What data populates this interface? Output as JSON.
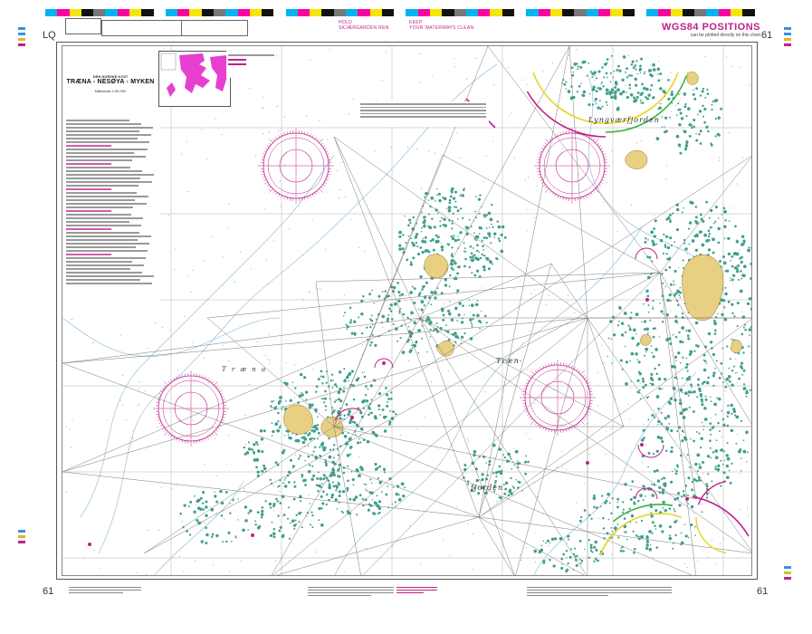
{
  "page": {
    "chart_number": "61",
    "corner_left": "LQ",
    "corner_right": "61"
  },
  "header": {
    "slogan_left": [
      "HOLD",
      "SKJÆRGARDEN REN"
    ],
    "slogan_right": [
      "KEEP",
      "YOUR WATERWAYS CLEAN"
    ],
    "wgs_title": "WGS84 POSITIONS",
    "wgs_sub": "can be plotted directly on this chart"
  },
  "title_block": {
    "pre_title": "DEN NORSKE KYST",
    "title": "TRÆNA - NESØYA - MYKEN",
    "scale": "Målestokk 1:50 000"
  },
  "place_names": {
    "lyngvaer": "Lyngværfjorden",
    "traena_w": "T r æ n a",
    "traena_c": "Træn-",
    "fjorden": "fjorden"
  },
  "colors": {
    "rock": "#3f9f8c",
    "land": "#e9cf82",
    "depth_line": "#9fc8e0",
    "magenta": "#c0208a",
    "line": "#7a7a7a",
    "yellow_sector": "#e6d51c",
    "green_sector": "#33b43f"
  },
  "colorbar": [
    "#00b4f0",
    "#ff00a0",
    "#f5e600",
    "#111111",
    "#777777",
    "#00b4f0",
    "#ff00a0",
    "#f5e600",
    "#111111",
    "#ffffff"
  ]
}
